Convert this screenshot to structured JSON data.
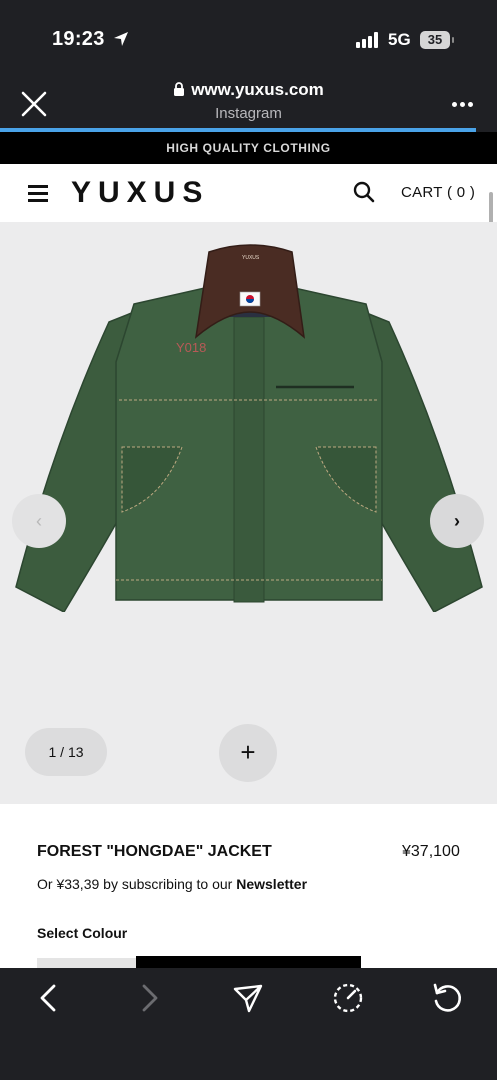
{
  "status_bar": {
    "time": "19:23",
    "network": "5G",
    "battery": "35",
    "icons": [
      "location-arrow-icon",
      "signal-icon",
      "battery-icon"
    ]
  },
  "browser": {
    "url": "www.yuxus.com",
    "source": "Instagram",
    "progress_color": "#4aa3e8"
  },
  "site": {
    "announcement": "HIGH QUALITY CLOTHING",
    "logo": "YUXUS",
    "cart_label": "CART ( 0 )"
  },
  "gallery": {
    "counter": "1 / 13",
    "prev_glyph": "‹",
    "next_glyph": "›",
    "zoom_glyph": "+",
    "image_text": {
      "brand_tag": "YUXUS",
      "embroidery": "Y018"
    },
    "jacket_color": "#3a5a3c",
    "collar_color": "#4a2c23"
  },
  "product": {
    "name": "FOREST \"HONGDAE\" JACKET",
    "price": "¥37,100",
    "subscribe_prefix": "Or ¥33,39 by subscribing to our ",
    "subscribe_link": "Newsletter",
    "colour_label": "Select Colour"
  },
  "toolbar": {
    "icons": [
      "back-icon",
      "forward-icon",
      "share-icon",
      "speed-icon",
      "reload-icon"
    ]
  }
}
